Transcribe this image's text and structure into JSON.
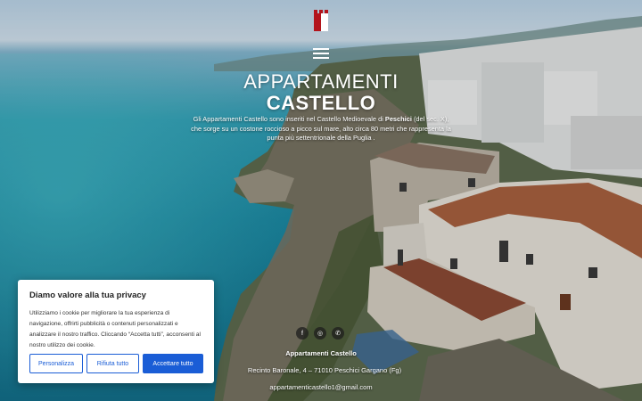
{
  "header": {
    "logo_icon": "castle-tower-icon",
    "menu_icon": "hamburger-menu-icon"
  },
  "hero": {
    "title_line1": "Appartamenti",
    "title_line2": "Castello",
    "intro_part1": "Gli Appartamenti Castello sono inseriti nel Castello Medioevale di ",
    "intro_bold": "Peschici",
    "intro_part2": " (del sec. X), che sorge su un costone roccioso a picco sul mare, alto circa 80 metri che rappresenta la punta più settentrionale della Puglia ."
  },
  "footer": {
    "socials": [
      {
        "icon": "facebook-icon",
        "glyph": "f"
      },
      {
        "icon": "instagram-icon",
        "glyph": "◎"
      },
      {
        "icon": "whatsapp-icon",
        "glyph": "✆"
      }
    ],
    "name": "Appartamenti Castello",
    "address": "Recinto Baronale, 4 – 71010 Peschici Gargano (Fg)",
    "email": "appartamenticastello1@gmail.com"
  },
  "cookie_banner": {
    "title": "Diamo valore alla tua privacy",
    "text": "Utilizziamo i cookie per migliorare la tua esperienza di navigazione, offrirti pubblicità o contenuti personalizzati e analizzare il nostro traffico. Cliccando “Accetta tutti”, acconsenti al nostro utilizzo dei cookie.",
    "customize_label": "Personalizza",
    "reject_label": "Rifiuta tutto",
    "accept_label": "Accettare tutto",
    "accent_color": "#1a5dd6"
  }
}
